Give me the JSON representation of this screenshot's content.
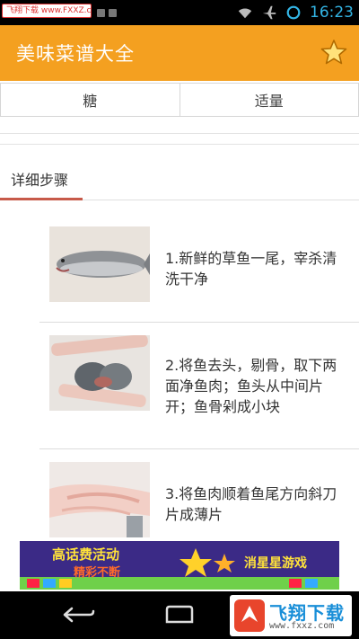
{
  "status_bar": {
    "watermark_url": "飞翔下载 www.FXXZ.com",
    "time": "16:23",
    "icons": [
      "wifi-icon",
      "airplane-icon",
      "sync-icon"
    ]
  },
  "action_bar": {
    "title": "美味菜谱大全",
    "favorite_icon": "star-icon"
  },
  "ingredient_row": {
    "name": "糖",
    "amount": "适量"
  },
  "section": {
    "title": "详细步骤"
  },
  "steps": [
    {
      "text": "1.新鲜的草鱼一尾，宰杀清洗干净"
    },
    {
      "text": "2.将鱼去头，剔骨，取下两面净鱼肉；鱼头从中间片开；鱼骨剁成小块"
    },
    {
      "text": "3.将鱼肉顺着鱼尾方向斜刀片成薄片"
    }
  ],
  "ad_banner": {
    "left_text_1": "高话费活动",
    "left_text_2": "精彩不断",
    "right_text": "消星星游戏"
  },
  "nav_bar": {
    "site_logo_name": "飞翔下载",
    "site_logo_url": "www.fxxz.com"
  },
  "colors": {
    "action_bar": "#f4a020",
    "accent_underline": "#c75a4a",
    "time": "#33b5e5"
  }
}
